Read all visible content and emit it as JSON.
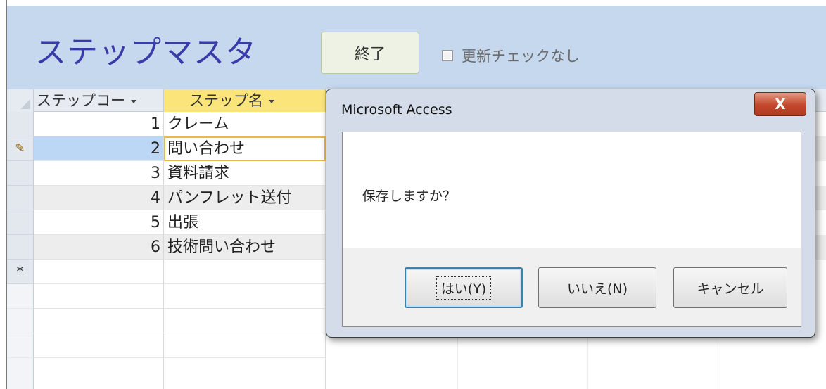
{
  "header": {
    "title": "ステップマスタ",
    "end_button": "終了",
    "no_update_check_label": "更新チェックなし",
    "background_color": "#c6d8ee",
    "title_color": "#3a3aa8"
  },
  "grid": {
    "columns": [
      "ステップコー",
      "ステップ名"
    ],
    "rows": [
      {
        "code": "1",
        "name": "クレーム"
      },
      {
        "code": "2",
        "name": "問い合わせ",
        "editing": true
      },
      {
        "code": "3",
        "name": "資料請求"
      },
      {
        "code": "4",
        "name": "パンフレット送付"
      },
      {
        "code": "5",
        "name": "出張"
      },
      {
        "code": "6",
        "name": "技術問い合わせ"
      }
    ],
    "new_row_marker": "*",
    "edit_marker_icon": "pencil-icon"
  },
  "dialog": {
    "title": "Microsoft Access",
    "close_label": "X",
    "message": "保存しますか？",
    "buttons": {
      "yes": "はい(Y)",
      "no": "いいえ(N)",
      "cancel": "キャンセル"
    }
  }
}
